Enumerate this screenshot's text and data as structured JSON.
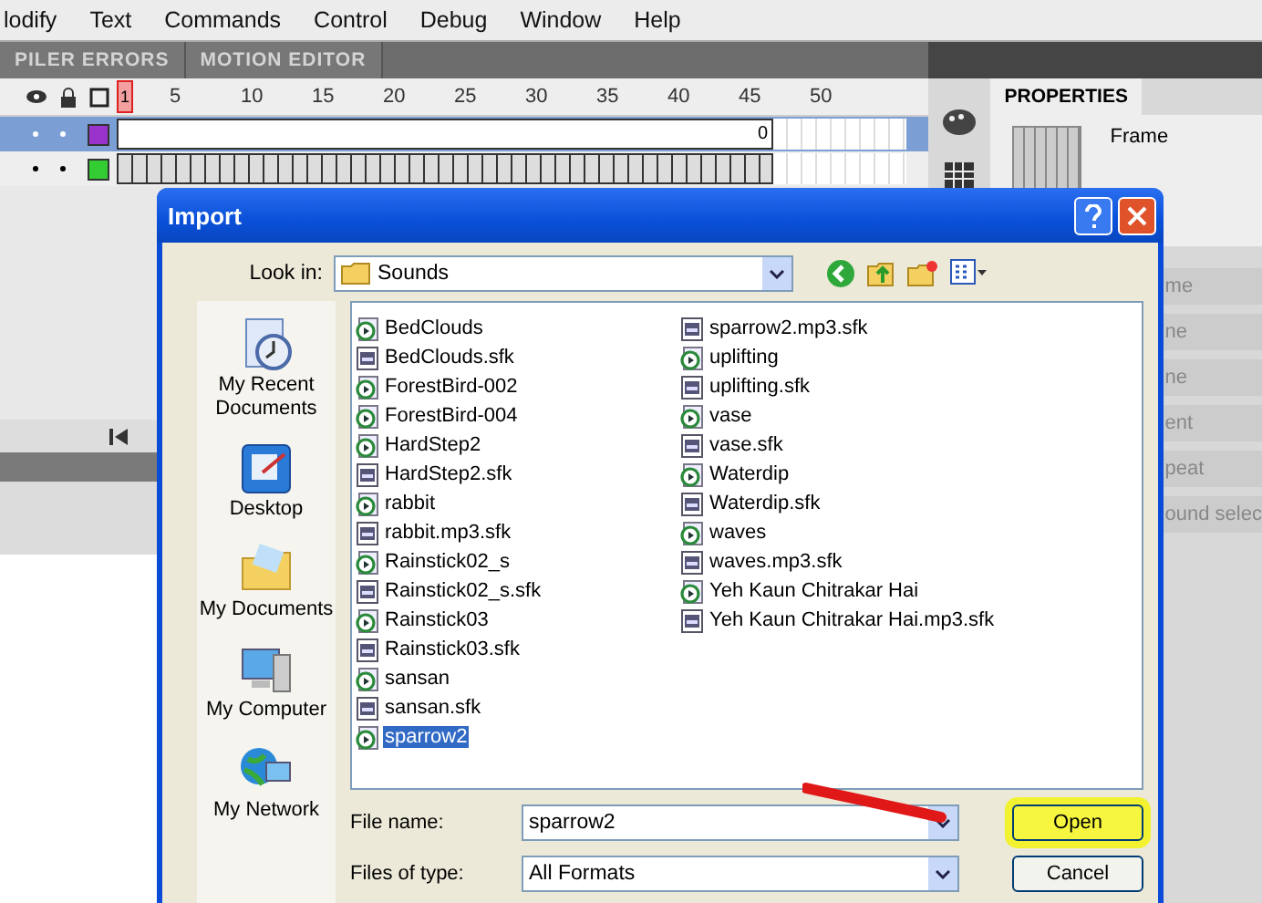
{
  "menu": [
    "lodify",
    "Text",
    "Commands",
    "Control",
    "Debug",
    "Window",
    "Help"
  ],
  "panel_tabs": [
    {
      "label": "PILER ERRORS",
      "selected": false
    },
    {
      "label": "MOTION EDITOR",
      "selected": false
    }
  ],
  "timeline": {
    "playhead": "1",
    "frame_numbers": [
      "5",
      "10",
      "15",
      "20",
      "25",
      "30",
      "35",
      "40",
      "45",
      "50"
    ],
    "layers": [
      {
        "selected": true,
        "color": "#9933cc",
        "end_label": "0"
      },
      {
        "selected": false,
        "color": "#33cc33"
      }
    ]
  },
  "properties": {
    "tab": "PROPERTIES",
    "label": "Frame",
    "fragments": [
      "me",
      "ne",
      "ne",
      "ent",
      "peat",
      "ound selec"
    ]
  },
  "dialog": {
    "title": "Import",
    "look_in_label": "Look in:",
    "look_in_value": "Sounds",
    "places": [
      {
        "label": "My Recent Documents",
        "kind": "recent"
      },
      {
        "label": "Desktop",
        "kind": "desktop"
      },
      {
        "label": "My Documents",
        "kind": "documents"
      },
      {
        "label": "My Computer",
        "kind": "computer"
      },
      {
        "label": "My Network",
        "kind": "network"
      }
    ],
    "files": [
      {
        "name": "BedClouds",
        "kind": "audio",
        "selected": false
      },
      {
        "name": "BedClouds.sfk",
        "kind": "sfk",
        "selected": false
      },
      {
        "name": "ForestBird-002",
        "kind": "audio",
        "selected": false
      },
      {
        "name": "ForestBird-004",
        "kind": "audio",
        "selected": false
      },
      {
        "name": "HardStep2",
        "kind": "audio",
        "selected": false
      },
      {
        "name": "HardStep2.sfk",
        "kind": "sfk",
        "selected": false
      },
      {
        "name": "rabbit",
        "kind": "audio",
        "selected": false
      },
      {
        "name": "rabbit.mp3.sfk",
        "kind": "sfk",
        "selected": false
      },
      {
        "name": "Rainstick02_s",
        "kind": "audio",
        "selected": false
      },
      {
        "name": "Rainstick02_s.sfk",
        "kind": "sfk",
        "selected": false
      },
      {
        "name": "Rainstick03",
        "kind": "audio",
        "selected": false
      },
      {
        "name": "Rainstick03.sfk",
        "kind": "sfk",
        "selected": false
      },
      {
        "name": "sansan",
        "kind": "audio",
        "selected": false
      },
      {
        "name": "sansan.sfk",
        "kind": "sfk",
        "selected": false
      },
      {
        "name": "sparrow2",
        "kind": "audio",
        "selected": true
      },
      {
        "name": "sparrow2.mp3.sfk",
        "kind": "sfk",
        "selected": false
      },
      {
        "name": "uplifting",
        "kind": "audio",
        "selected": false
      },
      {
        "name": "uplifting.sfk",
        "kind": "sfk",
        "selected": false
      },
      {
        "name": "vase",
        "kind": "audio",
        "selected": false
      },
      {
        "name": "vase.sfk",
        "kind": "sfk",
        "selected": false
      },
      {
        "name": "Waterdip",
        "kind": "audio",
        "selected": false
      },
      {
        "name": "Waterdip.sfk",
        "kind": "sfk",
        "selected": false
      },
      {
        "name": "waves",
        "kind": "audio",
        "selected": false
      },
      {
        "name": "waves.mp3.sfk",
        "kind": "sfk",
        "selected": false
      },
      {
        "name": "Yeh Kaun Chitrakar Hai",
        "kind": "audio",
        "selected": false
      },
      {
        "name": "Yeh Kaun Chitrakar Hai.mp3.sfk",
        "kind": "sfk",
        "selected": false
      }
    ],
    "file_name_label": "File name:",
    "file_name": "sparrow2",
    "file_type_label": "Files of type:",
    "file_type": "All Formats",
    "buttons": [
      {
        "label": "Open",
        "highlighted": true
      },
      {
        "label": "Cancel",
        "highlighted": false
      }
    ]
  }
}
